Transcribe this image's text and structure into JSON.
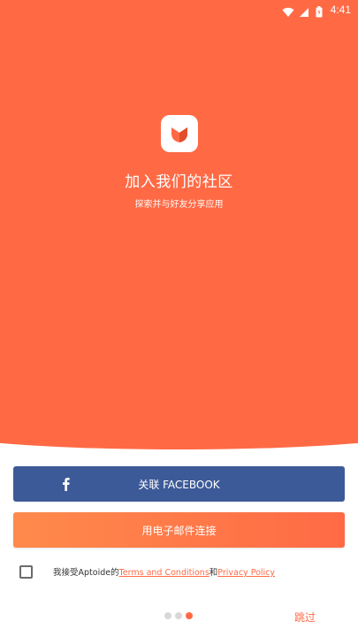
{
  "status_bar": {
    "time": "4:41"
  },
  "hero": {
    "title": "加入我们的社区",
    "subtitle": "探索并与好友分享应用"
  },
  "buttons": {
    "facebook_label": "关联 FACEBOOK",
    "email_label": "用电子邮件连接"
  },
  "terms": {
    "prefix": "我接受Aptoide的",
    "terms_link": "Terms and Conditions",
    "conjunction": "和",
    "privacy_link": "Privacy Policy",
    "checked": false
  },
  "pager": {
    "total": 3,
    "active_index": 2
  },
  "skip_label": "跳过",
  "colors": {
    "brand_orange": "#ff6a45",
    "facebook_blue": "#3d5a98",
    "email_gradient_start": "#ff8a4c"
  },
  "icons": [
    "wifi-icon",
    "signal-icon",
    "battery-icon",
    "aptoide-logo",
    "facebook-icon"
  ]
}
